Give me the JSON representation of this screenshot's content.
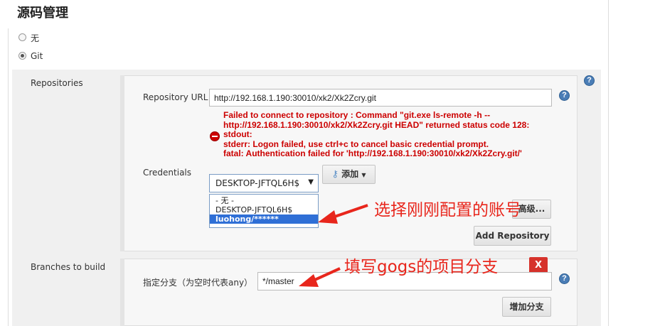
{
  "section": {
    "title": "源码管理"
  },
  "scm_options": [
    {
      "label": "无",
      "checked": false
    },
    {
      "label": "Git",
      "checked": true
    }
  ],
  "repositories": {
    "label": "Repositories",
    "url_label": "Repository URL",
    "url_value": "http://192.168.1.190:30010/xk2/Xk2Zcry.git",
    "error_lines": [
      "Failed to connect to repository : Command \"git.exe ls-remote -h --",
      "http://192.168.1.190:30010/xk2/Xk2Zcry.git HEAD\" returned status code 128:",
      "stdout:",
      "stderr: Logon failed, use ctrl+c to cancel basic credential prompt.",
      "fatal: Authentication failed for 'http://192.168.1.190:30010/xk2/Xk2Zcry.git/'"
    ],
    "credentials_label": "Credentials",
    "credentials_selected": "DESKTOP-JFTQL6H$",
    "credentials_options": [
      "- 无 -",
      "DESKTOP-JFTQL6H$",
      "luohong/******"
    ],
    "add_button": "添加",
    "advanced_button": "高级...",
    "add_repository_button": "Add Repository"
  },
  "branches": {
    "label": "Branches to build",
    "specifier_label": "指定分支（为空时代表any）",
    "specifier_value": "*/master",
    "add_branch_button": "增加分支",
    "delete_button": "X"
  },
  "annotations": {
    "credentials_note": "选择刚刚配置的账号",
    "branch_note": "填写gogs的项目分支"
  },
  "colors": {
    "error": "#cc0000",
    "annotation": "#e8261c",
    "selection": "#2f6fd6",
    "help": "#4a7db6"
  },
  "icons": [
    "help-icon",
    "error-icon",
    "key-icon",
    "chevron-down-icon",
    "close-icon"
  ]
}
